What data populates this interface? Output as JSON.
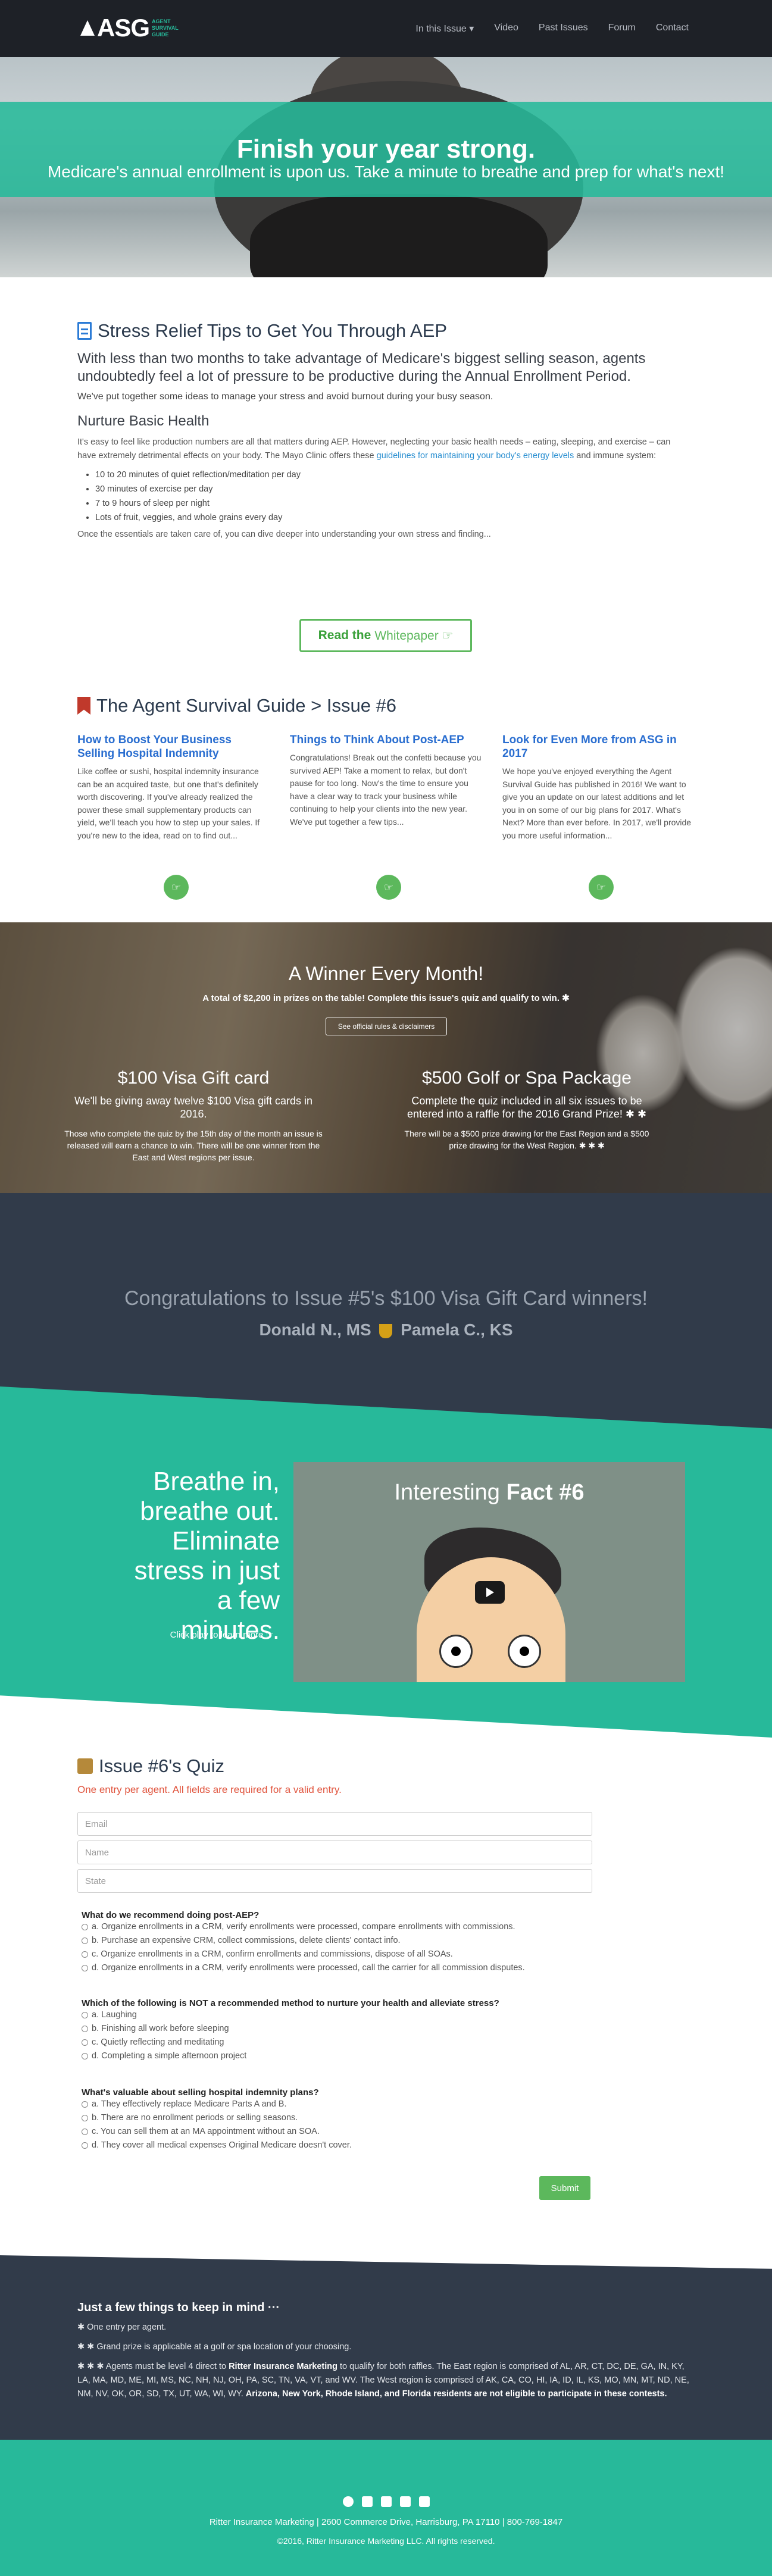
{
  "nav": {
    "logo": "ASG",
    "logo_sub": "AGENT SURVIVAL GUIDE",
    "items": [
      "In this Issue ▾",
      "Video",
      "Past Issues",
      "Forum",
      "Contact"
    ]
  },
  "hero": {
    "title": "Finish your year strong.",
    "subtitle": "Medicare's annual enrollment is upon us. Take a minute to breathe and prep for what's next!"
  },
  "article": {
    "title": "Stress Relief Tips to Get You Through AEP",
    "lead": "With less than two months to take advantage of Medicare's biggest selling season, agents undoubtedly feel a lot of pressure to be productive during the Annual Enrollment Period.",
    "p1": "We've put together some ideas to manage your stress and avoid burnout during your busy season.",
    "h3": "Nurture Basic Health",
    "p2": "It's easy to feel like production numbers are all that matters during AEP. However, neglecting your basic health needs – eating, sleeping, and exercise – can have extremely detrimental effects on your body. The Mayo Clinic offers these ",
    "p2_link": "guidelines for maintaining your body's energy levels",
    "p2_end": " and immune system:",
    "list": [
      "10 to 20 minutes of quiet reflection/meditation per day",
      "30 minutes of exercise per day",
      "7 to 9 hours of sleep per night",
      "Lots of fruit, veggies, and whole grains every day"
    ],
    "p3": "Once the essentials are taken care of, you can dive deeper into understanding your own stress and finding...",
    "button_bold": "Read the",
    "button_rest": "Whitepaper ☞"
  },
  "guide": {
    "title": "The Agent Survival Guide > Issue #6",
    "cols": [
      {
        "title": "How to Boost Your Business Selling Hospital Indemnity",
        "text": "Like coffee or sushi, hospital indemnity insurance can be an acquired taste, but one that's definitely worth discovering. If you've already realized the power these small supplementary products can yield, we'll teach you how to step up your sales. If you're new to the idea, read on to find out..."
      },
      {
        "title": "Things to Think About Post-AEP",
        "text": "Congratulations! Break out the confetti because you survived AEP! Take a moment to relax, but don't pause for too long. Now's the time to ensure you have a clear way to track your business while continuing to help your clients into the new year. We've put together a few tips..."
      },
      {
        "title": "Look for Even More from ASG in 2017",
        "text": "We hope you've enjoyed everything the Agent Survival Guide has published in 2016! We want to give you an update on our latest additions and let you in on some of our big plans for 2017. What's Next? More than ever before. In 2017, we'll provide you more useful information..."
      }
    ],
    "btn_icon": "☞"
  },
  "winner": {
    "title": "A Winner Every Month!",
    "sub": "A total of $2,200 in prizes on the table! Complete this issue's quiz and qualify to win. ✱",
    "rules": "See official rules & disclaimers",
    "left": {
      "title": "$100 Visa Gift card",
      "line": "We'll be giving away twelve $100 Visa gift cards in 2016.",
      "desc": "Those who complete the quiz by the 15th day of the month an issue is released will earn a chance to win. There will be one winner from the East and West regions per issue."
    },
    "right": {
      "title": "$500 Golf or Spa Package",
      "line": "Complete the quiz included in all six issues to be entered into a raffle for the 2016 Grand Prize! ✱ ✱",
      "desc": "There will be a $500 prize drawing for the East Region and a $500 prize drawing for the West Region. ✱ ✱ ✱"
    }
  },
  "congrats": {
    "title": "Congratulations to Issue #5's $100 Visa Gift Card winners!",
    "name1": "Donald N., MS",
    "name2": "Pamela C., KS"
  },
  "breathe": {
    "title": "Breathe in, breathe out. Eliminate stress in just a few minutes.",
    "link": "Click play to learn more ☞",
    "video_title": "Interesting",
    "video_bold": "Fact #6"
  },
  "quiz": {
    "title": "Issue #6's Quiz",
    "req": "One entry per agent. All fields are required for a valid entry.",
    "fields": {
      "email": "Email",
      "name": "Name",
      "state": "State"
    },
    "questions": [
      {
        "q": "What do we recommend doing post-AEP?",
        "opts": [
          "a. Organize enrollments in a CRM, verify enrollments were processed, compare enrollments with commissions.",
          "b. Purchase an expensive CRM, collect commissions, delete clients' contact info.",
          "c. Organize enrollments in a CRM, confirm enrollments and commissions, dispose of all SOAs.",
          "d. Organize enrollments in a CRM, verify enrollments were processed, call the carrier for all commission disputes."
        ]
      },
      {
        "q": "Which of the following is NOT a recommended method to nurture your health and alleviate stress?",
        "opts": [
          "a. Laughing",
          "b. Finishing all work before sleeping",
          "c. Quietly reflecting and meditating",
          "d. Completing a simple afternoon project"
        ]
      },
      {
        "q": "What's valuable about selling hospital indemnity plans?",
        "opts": [
          "a. They effectively replace Medicare Parts A and B.",
          "b. There are no enrollment periods or selling seasons.",
          "c. You can sell them at an MA appointment without an SOA.",
          "d. They cover all medical expenses Original Medicare doesn't cover."
        ]
      }
    ],
    "submit": "Submit"
  },
  "notes": {
    "title": "Just a few things to keep in mind ···",
    "n1": "✱ One entry per agent.",
    "n2": "✱ ✱ Grand prize is applicable at a golf or spa location of your choosing.",
    "n3a": "✱ ✱ ✱ Agents must be level 4 direct to ",
    "n3b": "Ritter Insurance Marketing",
    "n3c": " to qualify for both raffles. The East region is comprised of AL, AR, CT, DC, DE, GA, IN, KY, LA, MA, MD, ME, MI, MS, NC, NH, NJ, OH, PA, SC, TN, VA, VT, and WV. The West region is comprised of AK, CA, CO, HI, IA, ID, IL, KS, MO, MN, MT, ND, NE, NM, NV, OK, OR, SD, TX, UT, WA, WI, WY. ",
    "n3d": "Arizona, New York, Rhode Island, and Florida residents are not eligible to participate in these contests."
  },
  "footer": {
    "address": "Ritter Insurance Marketing | 2600 Commerce Drive, Harrisburg, PA 17110 | 800-769-1847",
    "copyright": "©2016, Ritter Insurance Marketing LLC. All rights reserved."
  },
  "colors": {
    "teal": "#27b99a",
    "dark": "#313b4a",
    "green": "#5cb85c",
    "blue": "#2a6ed0"
  }
}
